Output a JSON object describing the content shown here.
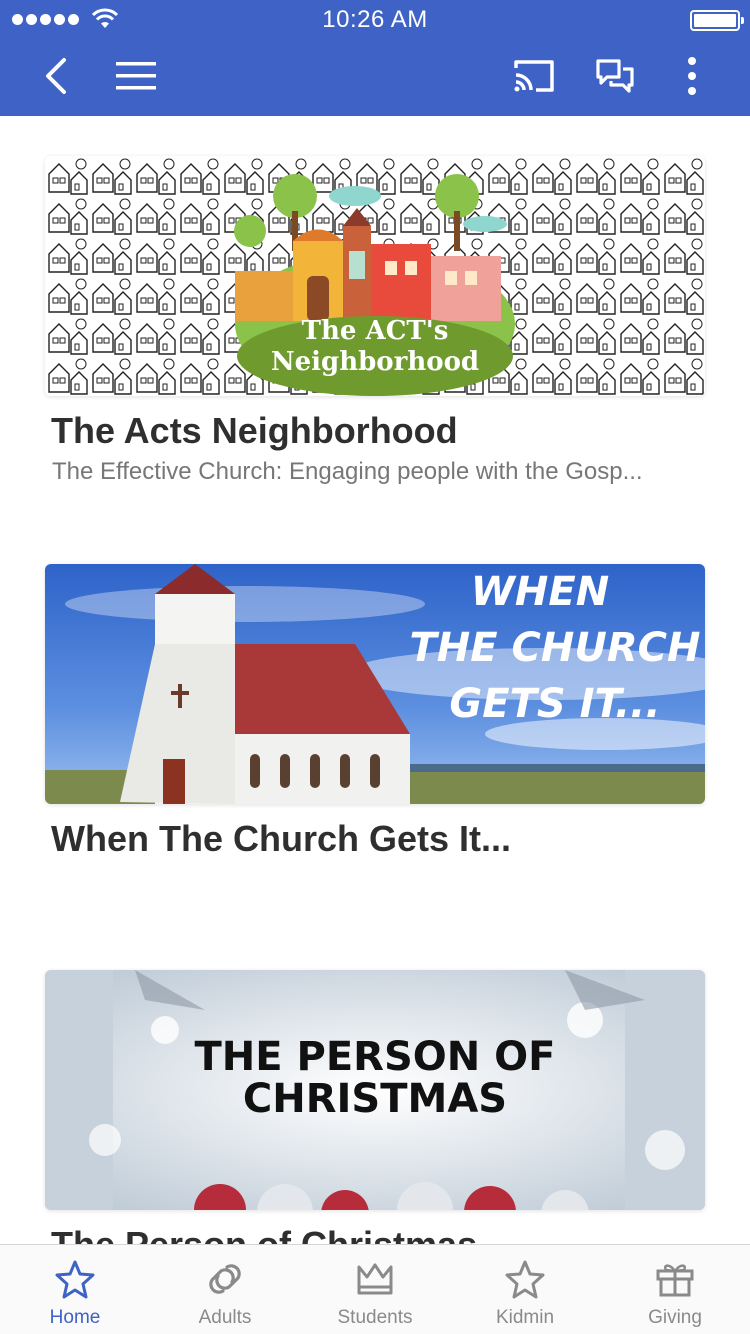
{
  "status_bar": {
    "time": "10:26 AM"
  },
  "colors": {
    "accent": "#3f62c6",
    "tab_inactive": "#8a8a8a",
    "title_text": "#2f2f2f",
    "subtitle_text": "#777777"
  },
  "nav": {
    "icons": [
      "back-icon",
      "menu-icon",
      "cast-icon",
      "chat-icon",
      "more-vertical-icon"
    ]
  },
  "cards": [
    {
      "title": "The Acts Neighborhood",
      "subtitle": "The Effective Church: Engaging people with the Gosp...",
      "art_text": [
        "The ACT's",
        "Neighborhood"
      ]
    },
    {
      "title": "When The Church Gets It...",
      "subtitle": "",
      "art_text": [
        "WHEN",
        "THE CHURCH",
        "GETS IT..."
      ]
    },
    {
      "title": "The Person of Christmas",
      "subtitle": "",
      "art_text": [
        "THE PERSON OF",
        "CHRISTMAS"
      ]
    }
  ],
  "tabs": [
    {
      "label": "Home",
      "icon": "star-icon",
      "active": true
    },
    {
      "label": "Adults",
      "icon": "link-icon",
      "active": false
    },
    {
      "label": "Students",
      "icon": "crown-icon",
      "active": false
    },
    {
      "label": "Kidmin",
      "icon": "star-icon",
      "active": false
    },
    {
      "label": "Giving",
      "icon": "gift-icon",
      "active": false
    }
  ]
}
